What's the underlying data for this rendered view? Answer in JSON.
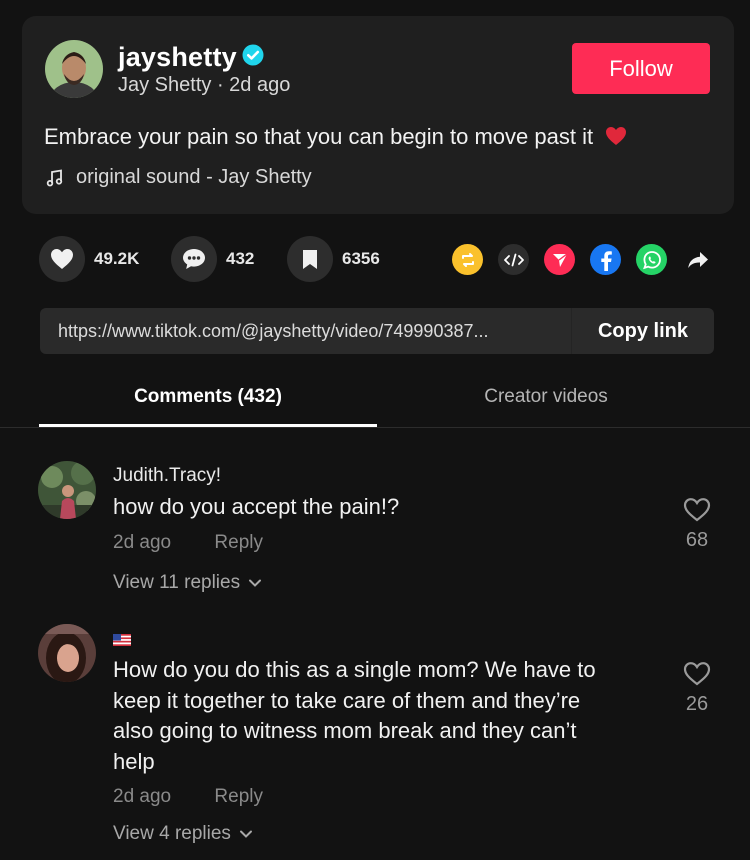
{
  "post": {
    "username": "jayshetty",
    "display_name": "Jay Shetty",
    "time_ago": "2d ago",
    "follow_label": "Follow",
    "caption": "Embrace your pain so that you can begin to move past it",
    "sound": "original sound - Jay Shetty"
  },
  "stats": {
    "likes": "49.2K",
    "comments": "432",
    "saves": "6356"
  },
  "share_icons": [
    "repost-icon",
    "embed-icon",
    "send-icon",
    "facebook-icon",
    "whatsapp-icon",
    "share-arrow-icon"
  ],
  "link": {
    "url": "https://www.tiktok.com/@jayshetty/video/749990387...",
    "copy_label": "Copy link"
  },
  "tabs": {
    "comments_label": "Comments (432)",
    "creator_label": "Creator videos"
  },
  "comments": [
    {
      "username": "Judith.Tracy!",
      "text_lines": [
        "how do you accept the pain!?"
      ],
      "time_ago": "2d ago",
      "reply_label": "Reply",
      "likes": "68",
      "view_replies": "View 11 replies"
    },
    {
      "username": "",
      "text_lines": [
        "How do you do this as a single mom? We have to",
        "keep it together to take care of them and they’re",
        "also going to witness mom break and they can’t",
        "help"
      ],
      "time_ago": "2d ago",
      "reply_label": "Reply",
      "likes": "26",
      "view_replies": "View 4 replies"
    }
  ],
  "colors": {
    "background": "#121212",
    "card": "#1f1f1f",
    "follow": "#fe2c55",
    "verified": "#20d5ec",
    "repost": "#fac12c",
    "send": "#fe2c55",
    "facebook": "#1877f2",
    "whatsapp": "#25d366"
  }
}
